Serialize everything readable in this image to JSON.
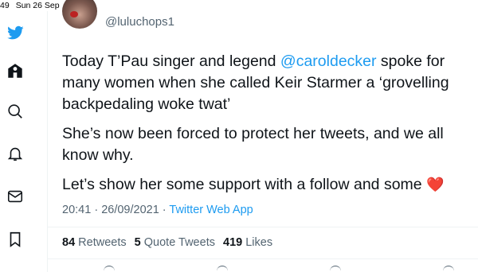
{
  "status_bar": {
    "time": "49",
    "date": "Sun 26 Sep"
  },
  "nav": {
    "icons": [
      "twitter-logo-icon",
      "home-icon",
      "explore-search-icon",
      "notifications-bell-icon",
      "messages-mail-icon",
      "bookmarks-icon"
    ],
    "brand_color": "#1d9bf0"
  },
  "tweet": {
    "handle": "@luluchops1",
    "para1_start": "Today T’Pau singer and legend ",
    "mention": "@caroldecker",
    "para1_end": " spoke for many women when she called Keir Starmer a ‘grovelling backpedaling woke twat’",
    "para2": "She’s now been forced to protect her tweets, and we all know why.",
    "para3": "Let’s show her some support with a follow and some ",
    "heart": "❤️",
    "time": "20:41",
    "date": "26/09/2021",
    "separator": " · ",
    "source": "Twitter Web App"
  },
  "stats": {
    "retweets_count": "84",
    "retweets_label": "Retweets",
    "quotes_count": "5",
    "quotes_label": "Quote Tweets",
    "likes_count": "419",
    "likes_label": "Likes"
  },
  "colors": {
    "text": "#0f1419",
    "secondary": "#536471",
    "accent": "#1d9bf0",
    "divider": "#eff3f4"
  }
}
